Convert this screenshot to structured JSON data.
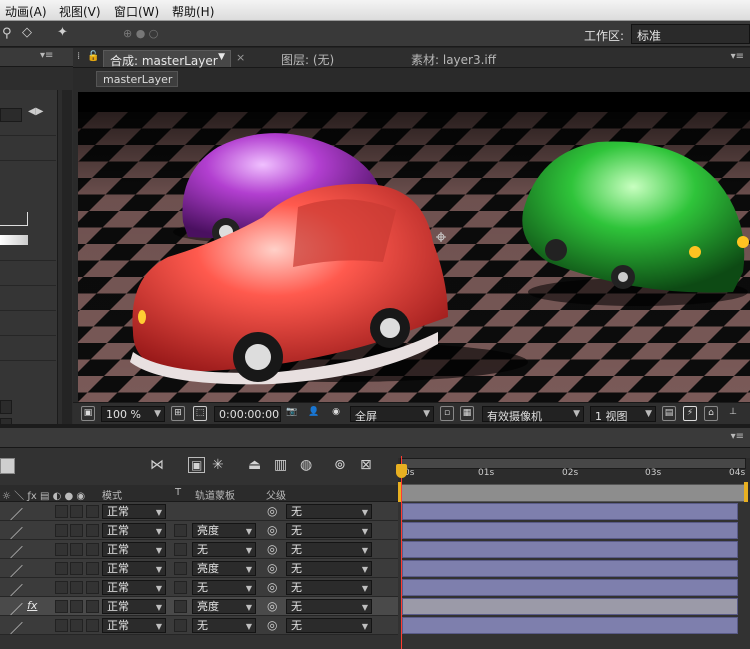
{
  "menu": [
    "动画(A)",
    "视图(V)",
    "窗口(W)",
    "帮助(H)"
  ],
  "workspace": {
    "label": "工作区:",
    "value": "标准"
  },
  "viewer": {
    "tabs": [
      {
        "label": "合成: masterLayer",
        "active": true
      },
      {
        "label": "图层: (无)",
        "active": false
      },
      {
        "label": "素材: layer3.iff",
        "active": false
      }
    ],
    "subtab": "masterLayer",
    "bottom_bar": {
      "zoom": "100 %",
      "timecode": "0:00:00:00",
      "resolution": "全屏",
      "camera": "有效摄像机",
      "views": "1 视图"
    }
  },
  "timeline": {
    "columns": {
      "mode": "模式",
      "track": "T",
      "trackmatte": "轨道蒙板",
      "parent": "父级"
    },
    "ruler": [
      "0s",
      "01s",
      "02s",
      "03s",
      "04s"
    ],
    "rows": [
      {
        "mode": "正常",
        "trackmatte": "",
        "parent": "无",
        "fx": false,
        "selected": false
      },
      {
        "mode": "正常",
        "trackmatte": "亮度",
        "parent": "无",
        "fx": false,
        "selected": false
      },
      {
        "mode": "正常",
        "trackmatte": "无",
        "parent": "无",
        "fx": false,
        "selected": false
      },
      {
        "mode": "正常",
        "trackmatte": "亮度",
        "parent": "无",
        "fx": false,
        "selected": false
      },
      {
        "mode": "正常",
        "trackmatte": "无",
        "parent": "无",
        "fx": false,
        "selected": false
      },
      {
        "mode": "正常",
        "trackmatte": "亮度",
        "parent": "无",
        "fx": true,
        "selected": true
      },
      {
        "mode": "正常",
        "trackmatte": "无",
        "parent": "无",
        "fx": false,
        "selected": false
      }
    ],
    "fx_label": "fx"
  },
  "colors": {
    "layer_bar": "#7e7fad",
    "cti": "#ff3b30",
    "cti_head": "#e8b021",
    "red_car": "#ff5a4e",
    "purple_car": "#b23fd0",
    "green_car": "#2fc43a"
  }
}
